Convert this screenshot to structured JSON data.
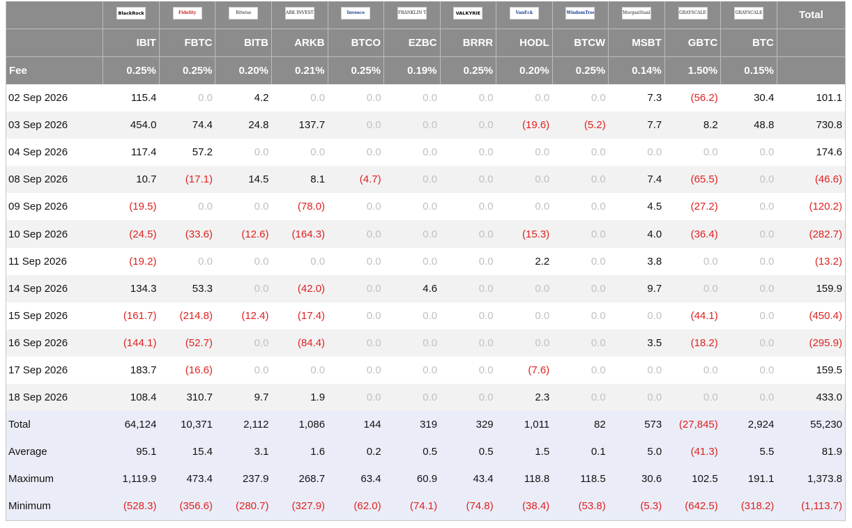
{
  "header": {
    "logos": [
      "BlackRock",
      "Fidelity",
      "Bitwise",
      "ARK INVEST",
      "Invesco",
      "FRANKLIN TEMPLETON",
      "VALKYRIE",
      "VanEck",
      "WisdomTree",
      "MorganStanley",
      "GRAYSCALE",
      "GRAYSCALE"
    ],
    "total_label": "Total",
    "tickers": [
      "IBIT",
      "FBTC",
      "BITB",
      "ARKB",
      "BTCO",
      "EZBC",
      "BRRR",
      "HODL",
      "BTCW",
      "MSBT",
      "GBTC",
      "BTC"
    ],
    "fee_label": "Fee",
    "fees": [
      "0.25%",
      "0.25%",
      "0.20%",
      "0.21%",
      "0.25%",
      "0.19%",
      "0.25%",
      "0.20%",
      "0.25%",
      "0.14%",
      "1.50%",
      "0.15%"
    ]
  },
  "rows": [
    {
      "date": "02 Sep 2026",
      "values": [
        "115.4",
        "0.0",
        "4.2",
        "0.0",
        "0.0",
        "0.0",
        "0.0",
        "0.0",
        "0.0",
        "7.3",
        "(56.2)",
        "30.4"
      ],
      "total": "101.1"
    },
    {
      "date": "03 Sep 2026",
      "values": [
        "454.0",
        "74.4",
        "24.8",
        "137.7",
        "0.0",
        "0.0",
        "0.0",
        "(19.6)",
        "(5.2)",
        "7.7",
        "8.2",
        "48.8"
      ],
      "total": "730.8"
    },
    {
      "date": "04 Sep 2026",
      "values": [
        "117.4",
        "57.2",
        "0.0",
        "0.0",
        "0.0",
        "0.0",
        "0.0",
        "0.0",
        "0.0",
        "0.0",
        "0.0",
        "0.0"
      ],
      "total": "174.6"
    },
    {
      "date": "08 Sep 2026",
      "values": [
        "10.7",
        "(17.1)",
        "14.5",
        "8.1",
        "(4.7)",
        "0.0",
        "0.0",
        "0.0",
        "0.0",
        "7.4",
        "(65.5)",
        "0.0"
      ],
      "total": "(46.6)"
    },
    {
      "date": "09 Sep 2026",
      "values": [
        "(19.5)",
        "0.0",
        "0.0",
        "(78.0)",
        "0.0",
        "0.0",
        "0.0",
        "0.0",
        "0.0",
        "4.5",
        "(27.2)",
        "0.0"
      ],
      "total": "(120.2)"
    },
    {
      "date": "10 Sep 2026",
      "values": [
        "(24.5)",
        "(33.6)",
        "(12.6)",
        "(164.3)",
        "0.0",
        "0.0",
        "0.0",
        "(15.3)",
        "0.0",
        "4.0",
        "(36.4)",
        "0.0"
      ],
      "total": "(282.7)"
    },
    {
      "date": "11 Sep 2026",
      "values": [
        "(19.2)",
        "0.0",
        "0.0",
        "0.0",
        "0.0",
        "0.0",
        "0.0",
        "2.2",
        "0.0",
        "3.8",
        "0.0",
        "0.0"
      ],
      "total": "(13.2)"
    },
    {
      "date": "14 Sep 2026",
      "values": [
        "134.3",
        "53.3",
        "0.0",
        "(42.0)",
        "0.0",
        "4.6",
        "0.0",
        "0.0",
        "0.0",
        "9.7",
        "0.0",
        "0.0"
      ],
      "total": "159.9"
    },
    {
      "date": "15 Sep 2026",
      "values": [
        "(161.7)",
        "(214.8)",
        "(12.4)",
        "(17.4)",
        "0.0",
        "0.0",
        "0.0",
        "0.0",
        "0.0",
        "0.0",
        "(44.1)",
        "0.0"
      ],
      "total": "(450.4)"
    },
    {
      "date": "16 Sep 2026",
      "values": [
        "(144.1)",
        "(52.7)",
        "0.0",
        "(84.4)",
        "0.0",
        "0.0",
        "0.0",
        "0.0",
        "0.0",
        "3.5",
        "(18.2)",
        "0.0"
      ],
      "total": "(295.9)"
    },
    {
      "date": "17 Sep 2026",
      "values": [
        "183.7",
        "(16.6)",
        "0.0",
        "0.0",
        "0.0",
        "0.0",
        "0.0",
        "(7.6)",
        "0.0",
        "0.0",
        "0.0",
        "0.0"
      ],
      "total": "159.5"
    },
    {
      "date": "18 Sep 2026",
      "values": [
        "108.4",
        "310.7",
        "9.7",
        "1.9",
        "0.0",
        "0.0",
        "0.0",
        "2.3",
        "0.0",
        "0.0",
        "0.0",
        "0.0"
      ],
      "total": "433.0"
    }
  ],
  "summary": [
    {
      "label": "Total",
      "values": [
        "64,124",
        "10,371",
        "2,112",
        "1,086",
        "144",
        "319",
        "329",
        "1,011",
        "82",
        "573",
        "(27,845)",
        "2,924"
      ],
      "total": "55,230"
    },
    {
      "label": "Average",
      "values": [
        "95.1",
        "15.4",
        "3.1",
        "1.6",
        "0.2",
        "0.5",
        "0.5",
        "1.5",
        "0.1",
        "5.0",
        "(41.3)",
        "5.5"
      ],
      "total": "81.9"
    },
    {
      "label": "Maximum",
      "values": [
        "1,119.9",
        "473.4",
        "237.9",
        "268.7",
        "63.4",
        "60.9",
        "43.4",
        "118.8",
        "118.5",
        "30.6",
        "102.5",
        "191.1"
      ],
      "total": "1,373.8"
    },
    {
      "label": "Minimum",
      "values": [
        "(528.3)",
        "(356.6)",
        "(280.7)",
        "(327.9)",
        "(62.0)",
        "(74.1)",
        "(74.8)",
        "(38.4)",
        "(53.8)",
        "(5.3)",
        "(642.5)",
        "(318.2)"
      ],
      "total": "(1,113.7)"
    }
  ],
  "colors": {
    "header_bg": "#8c8c8c",
    "negative": "#e02020",
    "zero": "#c0c0c0",
    "alt_row": "#f2f2f2",
    "summary_row": "#eaedf7"
  }
}
